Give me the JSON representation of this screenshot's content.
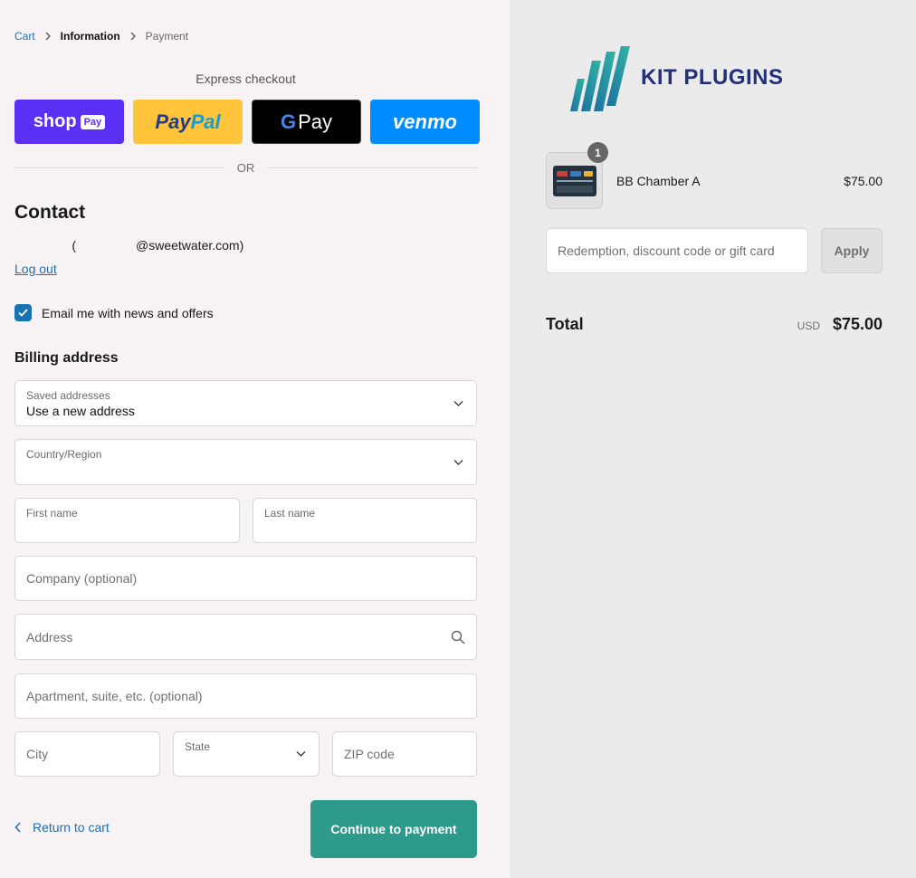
{
  "breadcrumb": {
    "cart": "Cart",
    "information": "Information",
    "payment": "Payment"
  },
  "express": {
    "title": "Express checkout",
    "shop_label": "shop",
    "shop_pay_label": "Pay",
    "paypal_part1": "Pay",
    "paypal_part2": "Pal",
    "gpay_g": "G",
    "gpay_label": "Pay",
    "venmo_label": "venmo",
    "or": "OR"
  },
  "contact": {
    "heading": "Contact",
    "email_suffix": "@sweetwater.com)",
    "email_open": "(",
    "logout": "Log out",
    "newsletter_label": "Email me with news and offers",
    "newsletter_checked": true
  },
  "billing": {
    "heading": "Billing address",
    "saved_label": "Saved addresses",
    "saved_value": "Use a new address",
    "country_label": "Country/Region",
    "country_value": "",
    "first_name_label": "First name",
    "last_name_label": "Last name",
    "company_placeholder": "Company (optional)",
    "address_placeholder": "Address",
    "apartment_placeholder": "Apartment, suite, etc. (optional)",
    "city_placeholder": "City",
    "state_label": "State",
    "zip_placeholder": "ZIP code"
  },
  "actions": {
    "return": "Return to cart",
    "continue": "Continue to payment"
  },
  "summary": {
    "brand": "KIT PLUGINS",
    "item": {
      "name": "BB Chamber A",
      "price": "$75.00",
      "quantity": "1"
    },
    "discount_placeholder": "Redemption, discount code or gift card",
    "apply": "Apply",
    "total_label": "Total",
    "currency": "USD",
    "total_amount": "$75.00"
  },
  "colors": {
    "accent": "#2e9a8c",
    "link": "#1f6fb0",
    "shop_pay": "#5a31f4",
    "paypal": "#ffc439",
    "venmo": "#008cff",
    "brand": "#23307a"
  }
}
